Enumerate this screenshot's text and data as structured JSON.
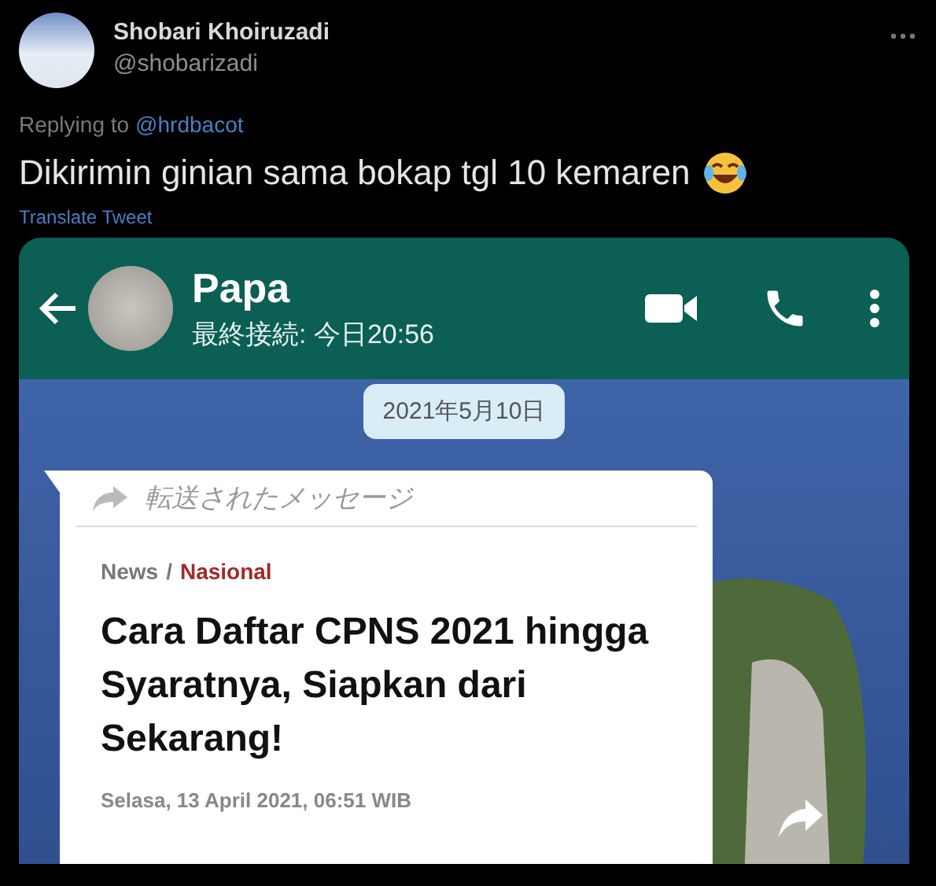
{
  "tweet": {
    "author_name": "Shobari Khoiruzadi",
    "handle": "@shobarizadi",
    "replying_to_label": "Replying to",
    "replying_to_handle": "@hrdbacot",
    "text": "Dikirimin ginian sama bokap tgl 10 kemaren",
    "translate_link": "Translate Tweet"
  },
  "chat": {
    "contact_name": "Papa",
    "last_seen": "最終接続: 今日20:56",
    "date_chip": "2021年5月10日",
    "message": {
      "forwarded_label": "転送されたメッセージ",
      "section": "News",
      "separator": "/",
      "category": "Nasional",
      "headline": "Cara Daftar CPNS 2021 hingga Syaratnya, Siapkan dari Sekarang!",
      "date": "Selasa, 13 April 2021, 06:51 WIB"
    }
  }
}
